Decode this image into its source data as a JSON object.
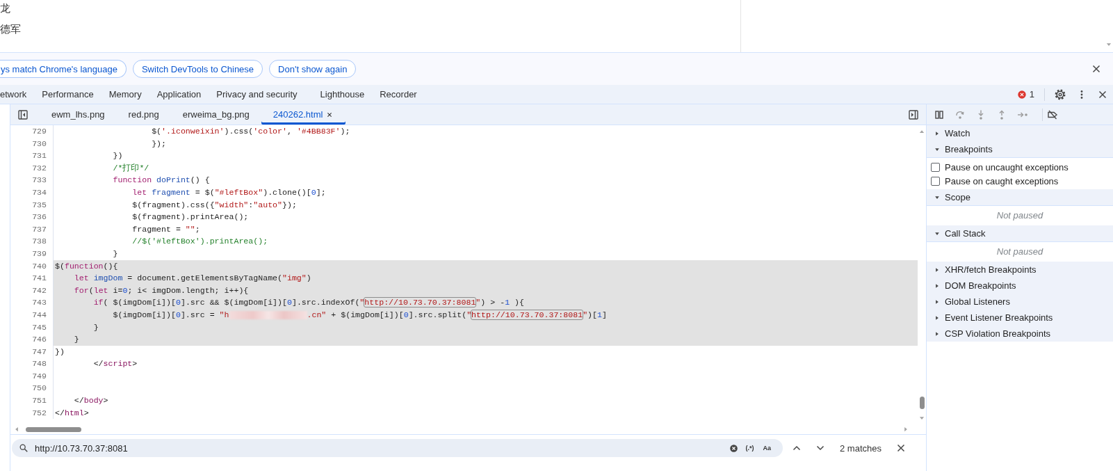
{
  "page": {
    "lines": [
      "龙",
      "德军"
    ]
  },
  "infobar": {
    "buttons": [
      "ys match Chrome's language",
      "Switch DevTools to Chinese",
      "Don't show again"
    ]
  },
  "panel_tabs": [
    {
      "label": "etwork",
      "selected": false
    },
    {
      "label": "Performance",
      "selected": false
    },
    {
      "label": "Memory",
      "selected": false
    },
    {
      "label": "Application",
      "selected": false
    },
    {
      "label": "Privacy and security",
      "selected": false
    },
    {
      "label": "Lighthouse",
      "selected": false
    },
    {
      "label": "Recorder",
      "selected": false
    }
  ],
  "error_count": "1",
  "file_tabs": [
    {
      "label": "ewm_lhs.png",
      "selected": false
    },
    {
      "label": "red.png",
      "selected": false
    },
    {
      "label": "erweima_bg.png",
      "selected": false
    },
    {
      "label": "240262.html",
      "selected": true
    }
  ],
  "editor": {
    "lines": [
      {
        "number": "729",
        "highlighted": false,
        "tokens": [
          {
            "kind": "plain",
            "text": "                    $("
          },
          {
            "kind": "string",
            "text": "'.iconweixin'"
          },
          {
            "kind": "plain",
            "text": ").css("
          },
          {
            "kind": "string",
            "text": "'color'"
          },
          {
            "kind": "plain",
            "text": ", "
          },
          {
            "kind": "string",
            "text": "'#4BB83F'"
          },
          {
            "kind": "plain",
            "text": ");"
          }
        ]
      },
      {
        "number": "730",
        "highlighted": false,
        "tokens": [
          {
            "kind": "plain",
            "text": "                    });"
          }
        ]
      },
      {
        "number": "731",
        "highlighted": false,
        "tokens": [
          {
            "kind": "plain",
            "text": "            })"
          }
        ]
      },
      {
        "number": "732",
        "highlighted": false,
        "tokens": [
          {
            "kind": "comment",
            "text": "            /*打印*/"
          }
        ]
      },
      {
        "number": "733",
        "highlighted": false,
        "tokens": [
          {
            "kind": "keyword",
            "text": "            function"
          },
          {
            "kind": "def",
            "text": " doPrint"
          },
          {
            "kind": "plain",
            "text": "() {"
          }
        ]
      },
      {
        "number": "734",
        "highlighted": false,
        "tokens": [
          {
            "kind": "keyword",
            "text": "                let"
          },
          {
            "kind": "def",
            "text": " fragment"
          },
          {
            "kind": "plain",
            "text": " = $("
          },
          {
            "kind": "string",
            "text": "\"#leftBox\""
          },
          {
            "kind": "plain",
            "text": ").clone()["
          },
          {
            "kind": "number",
            "text": "0"
          },
          {
            "kind": "plain",
            "text": "];"
          }
        ]
      },
      {
        "number": "735",
        "highlighted": false,
        "tokens": [
          {
            "kind": "plain",
            "text": "                $(fragment).css({"
          },
          {
            "kind": "string",
            "text": "\"width\""
          },
          {
            "kind": "plain",
            "text": ":"
          },
          {
            "kind": "string",
            "text": "\"auto\""
          },
          {
            "kind": "plain",
            "text": "});"
          }
        ]
      },
      {
        "number": "736",
        "highlighted": false,
        "tokens": [
          {
            "kind": "plain",
            "text": "                $(fragment).printArea();"
          }
        ]
      },
      {
        "number": "737",
        "highlighted": false,
        "tokens": [
          {
            "kind": "plain",
            "text": "                fragment = "
          },
          {
            "kind": "string",
            "text": "\"\""
          },
          {
            "kind": "plain",
            "text": ";"
          }
        ]
      },
      {
        "number": "738",
        "highlighted": false,
        "tokens": [
          {
            "kind": "comment",
            "text": "                //$('#leftBox').printArea();"
          }
        ]
      },
      {
        "number": "739",
        "highlighted": false,
        "tokens": [
          {
            "kind": "plain",
            "text": "            }"
          }
        ]
      },
      {
        "number": "740",
        "highlighted": true,
        "tokens": [
          {
            "kind": "plain",
            "text": "$("
          },
          {
            "kind": "keyword",
            "text": "function"
          },
          {
            "kind": "plain",
            "text": "(){"
          }
        ]
      },
      {
        "number": "741",
        "highlighted": true,
        "tokens": [
          {
            "kind": "keyword",
            "text": "    let"
          },
          {
            "kind": "def",
            "text": " imgDom"
          },
          {
            "kind": "plain",
            "text": " = document.getElementsByTagName("
          },
          {
            "kind": "string",
            "text": "\"img\""
          },
          {
            "kind": "plain",
            "text": ")"
          }
        ]
      },
      {
        "number": "742",
        "highlighted": true,
        "tokens": [
          {
            "kind": "keyword",
            "text": "    for"
          },
          {
            "kind": "plain",
            "text": "("
          },
          {
            "kind": "keyword",
            "text": "let"
          },
          {
            "kind": "plain",
            "text": " i="
          },
          {
            "kind": "number",
            "text": "0"
          },
          {
            "kind": "plain",
            "text": "; i< imgDom.length; i++){"
          }
        ]
      },
      {
        "number": "743",
        "highlighted": true,
        "tokens": [
          {
            "kind": "keyword",
            "text": "        if"
          },
          {
            "kind": "plain",
            "text": "( $(imgDom[i])["
          },
          {
            "kind": "number",
            "text": "0"
          },
          {
            "kind": "plain",
            "text": "].src && $(imgDom[i])["
          },
          {
            "kind": "number",
            "text": "0"
          },
          {
            "kind": "plain",
            "text": "].src.indexOf("
          },
          {
            "kind": "string",
            "text": "\""
          },
          {
            "kind": "match",
            "text": "http://10.73.70.37:8081"
          },
          {
            "kind": "string",
            "text": "\""
          },
          {
            "kind": "plain",
            "text": ") > -"
          },
          {
            "kind": "number",
            "text": "1"
          },
          {
            "kind": "plain",
            "text": " ){"
          }
        ]
      },
      {
        "number": "744",
        "highlighted": true,
        "tokens": [
          {
            "kind": "plain",
            "text": "            $(imgDom[i])["
          },
          {
            "kind": "number",
            "text": "0"
          },
          {
            "kind": "plain",
            "text": "].src = "
          },
          {
            "kind": "string",
            "text": "\"h"
          },
          {
            "kind": "redacted"
          },
          {
            "kind": "string",
            "text": ".cn\""
          },
          {
            "kind": "plain",
            "text": " + $(imgDom[i])["
          },
          {
            "kind": "number",
            "text": "0"
          },
          {
            "kind": "plain",
            "text": "].src.split("
          },
          {
            "kind": "string",
            "text": "\""
          },
          {
            "kind": "match",
            "text": "http://10.73.70.37:8081"
          },
          {
            "kind": "string",
            "text": "\""
          },
          {
            "kind": "plain",
            "text": ")["
          },
          {
            "kind": "number",
            "text": "1"
          },
          {
            "kind": "plain",
            "text": "]"
          }
        ]
      },
      {
        "number": "745",
        "highlighted": true,
        "tokens": [
          {
            "kind": "plain",
            "text": "        }"
          }
        ]
      },
      {
        "number": "746",
        "highlighted": true,
        "tokens": [
          {
            "kind": "plain",
            "text": "    }"
          }
        ]
      },
      {
        "number": "747",
        "highlighted": false,
        "tokens": [
          {
            "kind": "plain",
            "text": "})"
          }
        ]
      },
      {
        "number": "748",
        "highlighted": false,
        "tokens": [
          {
            "kind": "plain",
            "text": "        </"
          },
          {
            "kind": "tag",
            "text": "script"
          },
          {
            "kind": "plain",
            "text": ">"
          }
        ]
      },
      {
        "number": "749",
        "highlighted": false
      },
      {
        "number": "750",
        "highlighted": false
      },
      {
        "number": "751",
        "highlighted": false,
        "tokens": [
          {
            "kind": "plain",
            "text": "    </"
          },
          {
            "kind": "tag",
            "text": "body"
          },
          {
            "kind": "plain",
            "text": ">"
          }
        ]
      },
      {
        "number": "752",
        "highlighted": false,
        "tokens": [
          {
            "kind": "plain",
            "text": "</"
          },
          {
            "kind": "tag",
            "text": "html"
          },
          {
            "kind": "plain",
            "text": ">"
          }
        ]
      }
    ]
  },
  "search": {
    "value": "http://10.73.70.37:8081",
    "regex_label": "(.*)",
    "case_label": "Aa",
    "match_count": "2 matches"
  },
  "sidebar": {
    "sections": [
      {
        "title": "Watch",
        "expanded": false
      },
      {
        "title": "Breakpoints",
        "expanded": true,
        "checkboxes": [
          {
            "label": "Pause on uncaught exceptions",
            "checked": false
          },
          {
            "label": "Pause on caught exceptions",
            "checked": false
          }
        ]
      },
      {
        "title": "Scope",
        "expanded": true,
        "message": "Not paused"
      },
      {
        "title": "Call Stack",
        "expanded": true,
        "message": "Not paused"
      },
      {
        "title": "XHR/fetch Breakpoints",
        "expanded": false
      },
      {
        "title": "DOM Breakpoints",
        "expanded": false
      },
      {
        "title": "Global Listeners",
        "expanded": false
      },
      {
        "title": "Event Listener Breakpoints",
        "expanded": false
      },
      {
        "title": "CSP Violation Breakpoints",
        "expanded": false
      }
    ]
  }
}
